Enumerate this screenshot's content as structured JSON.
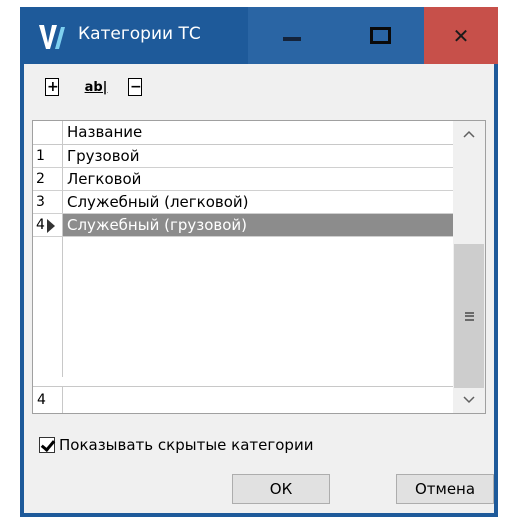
{
  "window": {
    "title": "Категории ТС"
  },
  "titlebar": {
    "buttons": {
      "minimize_icon": "minimize-icon",
      "maximize_icon": "maximize-icon",
      "close_icon": "close-icon",
      "close_glyph": "✕"
    },
    "colors": {
      "frame": "#1e5a9a",
      "buttons": "#2a65a4",
      "close": "#c7504a"
    }
  },
  "toolbar": {
    "tools": [
      {
        "icon": "add-record-icon"
      },
      {
        "icon": "rename-icon",
        "glyph": "ab|"
      },
      {
        "icon": "delete-record-icon"
      }
    ]
  },
  "grid": {
    "header": "Название",
    "rows": [
      {
        "index": "1",
        "name": "Грузовой"
      },
      {
        "index": "2",
        "name": "Легковой"
      },
      {
        "index": "3",
        "name": "Служебный (легковой)"
      },
      {
        "index": "4",
        "name": "Служебный (грузовой)",
        "selected": true
      }
    ],
    "footer_count": "4",
    "selection_color": "#8c8c8c"
  },
  "options": {
    "show_hidden_label": "Показывать скрытые категории",
    "show_hidden_checked": true
  },
  "buttons": {
    "ok": "ОК",
    "cancel": "Отмена"
  }
}
